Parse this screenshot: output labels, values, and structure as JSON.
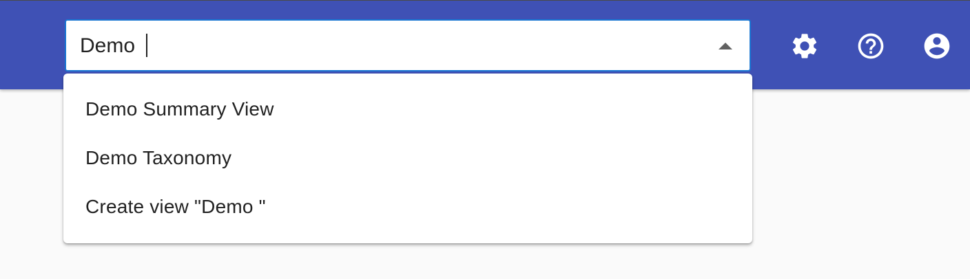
{
  "header": {
    "background_color": "#3f51b5",
    "search": {
      "value": "Demo ",
      "focus_color": "#1976d2",
      "toggle_icon": "arrow-up-icon"
    },
    "actions": [
      {
        "icon": "gear-icon"
      },
      {
        "icon": "help-circle-icon"
      },
      {
        "icon": "account-circle-icon"
      }
    ]
  },
  "dropdown": {
    "options": [
      {
        "label": "Demo Summary View"
      },
      {
        "label": "Demo Taxonomy"
      },
      {
        "label": "Create view \"Demo \""
      }
    ]
  }
}
